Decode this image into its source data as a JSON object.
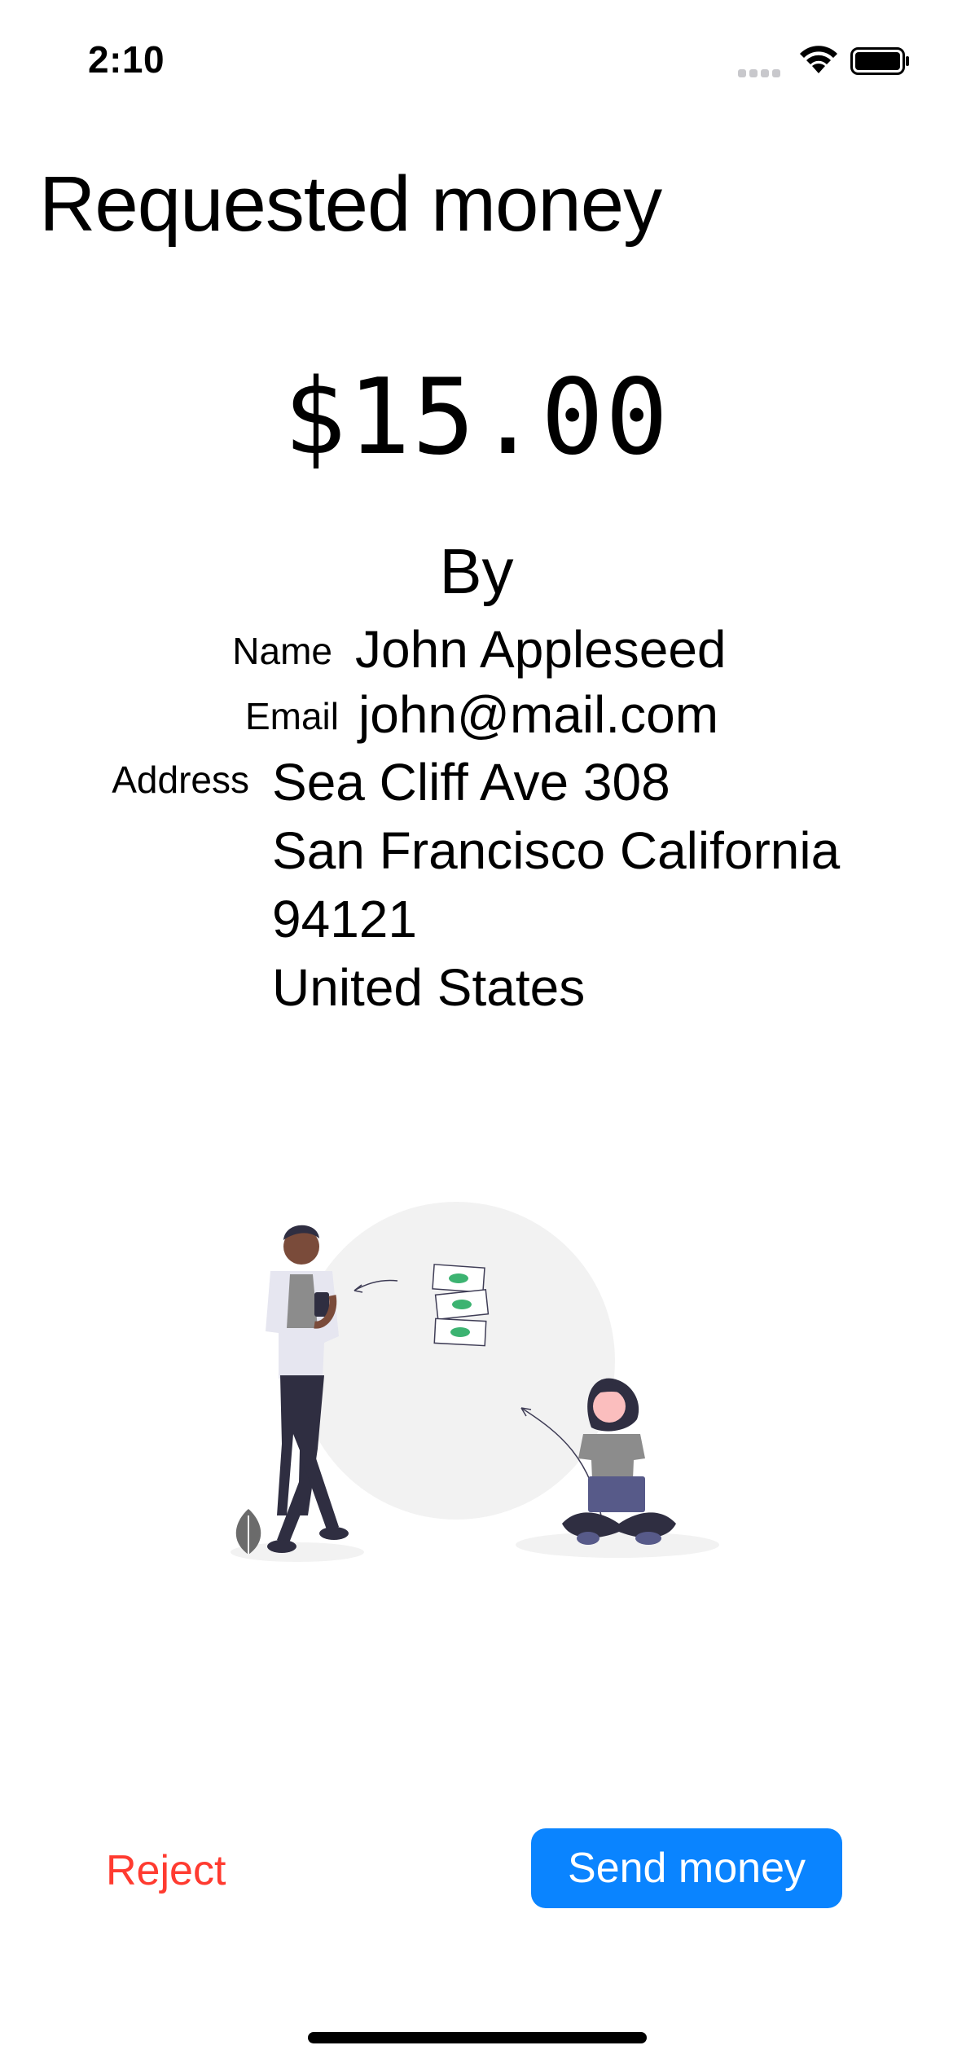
{
  "status_bar": {
    "time": "2:10",
    "icons": [
      "cellular-signal-icon",
      "wifi-icon",
      "battery-icon"
    ]
  },
  "page_title": "Requested money",
  "amount": "$15.00",
  "requester": {
    "by_label": "By",
    "name_label": "Name",
    "name": "John Appleseed",
    "email_label": "Email",
    "email": "john@mail.com",
    "address_label": "Address",
    "address_lines": [
      "Sea Cliff Ave 308",
      "San Francisco  California",
      "94121",
      "United States"
    ]
  },
  "illustration": {
    "icon": "send-money-illustration"
  },
  "actions": {
    "reject_label": "Reject",
    "send_label": "Send money"
  },
  "colors": {
    "accent": "#0a84ff",
    "destructive": "#ff3b30",
    "illustration_bg": "#f2f2f2",
    "illustration_dark": "#2f2e41",
    "illustration_green": "#3cb371"
  }
}
